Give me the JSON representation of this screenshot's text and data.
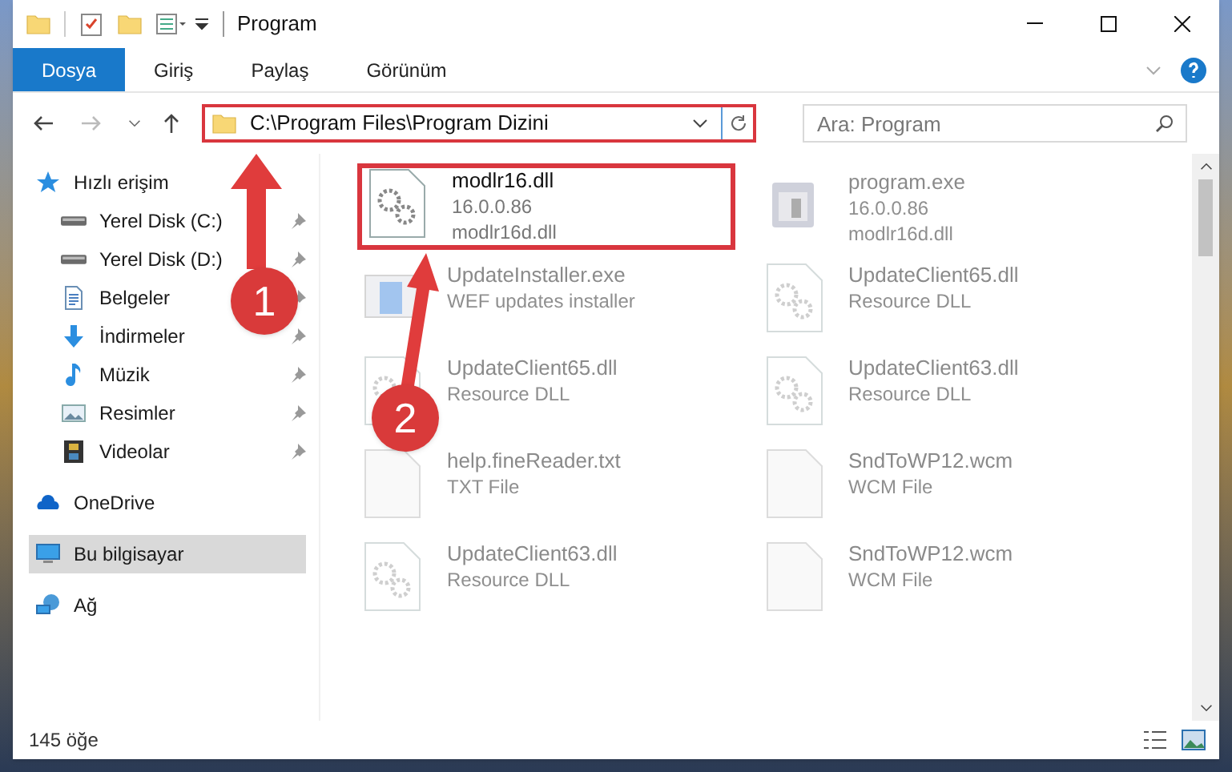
{
  "window": {
    "title": "Program"
  },
  "ribbon_tabs": [
    {
      "label": "Dosya",
      "selected": true
    },
    {
      "label": "Giriş",
      "selected": false
    },
    {
      "label": "Paylaş",
      "selected": false
    },
    {
      "label": "Görünüm",
      "selected": false
    }
  ],
  "address_bar": {
    "path": "C:\\Program Files\\Program Dizini",
    "highlighted": true
  },
  "search": {
    "placeholder": "Ara: Program"
  },
  "sidebar": {
    "items": [
      {
        "label": "Hızlı erişim",
        "kind": "star",
        "selected": false,
        "children": [
          {
            "label": "Yerel Disk (C:)",
            "kind": "drive",
            "selected": false,
            "pinned": true
          },
          {
            "label": "Yerel Disk (D:)",
            "kind": "drive",
            "selected": false,
            "pinned": true
          },
          {
            "label": "Belgeler",
            "kind": "document",
            "selected": false,
            "pinned": true
          },
          {
            "label": "İndirmeler",
            "kind": "download",
            "selected": false,
            "pinned": true
          },
          {
            "label": "Müzik",
            "kind": "music",
            "selected": false,
            "pinned": true
          },
          {
            "label": "Resimler",
            "kind": "pictures",
            "selected": false,
            "pinned": true
          },
          {
            "label": "Videolar",
            "kind": "video",
            "selected": false,
            "pinned": true
          }
        ]
      },
      {
        "label": "OneDrive",
        "kind": "cloud",
        "selected": false
      },
      {
        "label": "Bu bilgisayar",
        "kind": "computer",
        "selected": true
      },
      {
        "label": "Ağ",
        "kind": "network",
        "selected": false
      }
    ]
  },
  "files": [
    {
      "name": "modlr16.dll",
      "details": [
        "16.0.0.86",
        "modlr16d.dll"
      ],
      "kind": "dll",
      "dimmed": false,
      "highlighted": true
    },
    {
      "name": "program.exe",
      "details": [
        "16.0.0.86",
        "modlr16d.dll"
      ],
      "kind": "exe",
      "dimmed": true
    },
    {
      "name": "UpdateInstaller.exe",
      "details": [
        "WEF updates installer"
      ],
      "kind": "installer",
      "dimmed": true
    },
    {
      "name": "UpdateClient65.dll",
      "details": [
        "Resource DLL"
      ],
      "kind": "dll",
      "dimmed": true
    },
    {
      "name": "UpdateClient65.dll",
      "details": [
        "Resource DLL"
      ],
      "kind": "dll",
      "dimmed": true
    },
    {
      "name": "UpdateClient63.dll",
      "details": [
        "Resource DLL"
      ],
      "kind": "dll",
      "dimmed": true
    },
    {
      "name": "help.fineReader.txt",
      "details": [
        "TXT File"
      ],
      "kind": "text",
      "dimmed": true
    },
    {
      "name": "SndToWP12.wcm",
      "details": [
        "WCM File"
      ],
      "kind": "text",
      "dimmed": true
    },
    {
      "name": "UpdateClient63.dll",
      "details": [
        "Resource DLL"
      ],
      "kind": "dll",
      "dimmed": true
    },
    {
      "name": "SndToWP12.wcm",
      "details": [
        "WCM File"
      ],
      "kind": "text",
      "dimmed": true
    }
  ],
  "status_bar": {
    "count": "145 öğe"
  },
  "annotations": [
    {
      "number": "1"
    },
    {
      "number": "2"
    }
  ]
}
